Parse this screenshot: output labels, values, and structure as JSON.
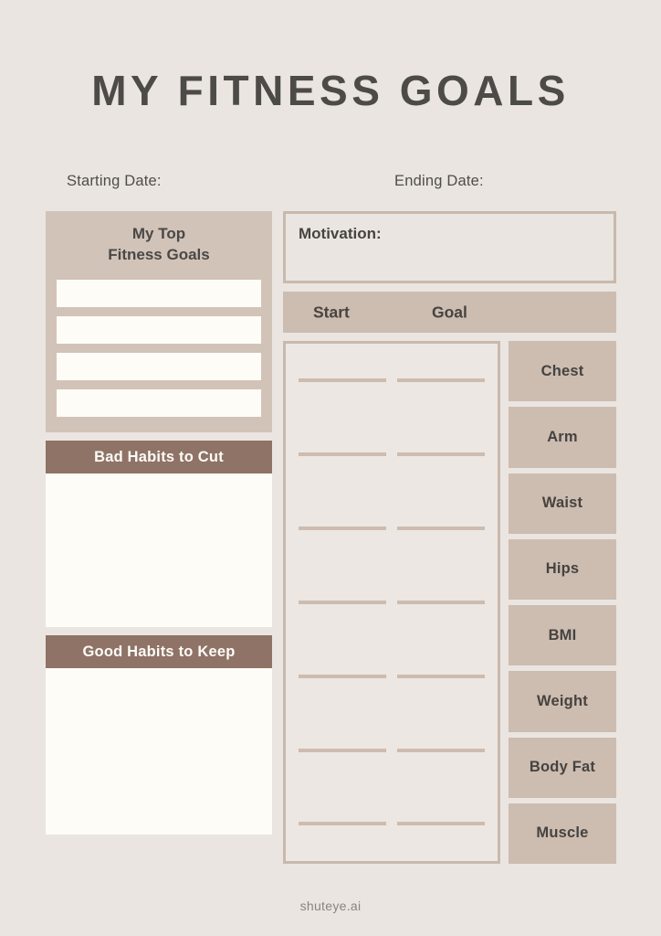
{
  "page": {
    "title": "MY FITNESS GOALS",
    "background_color": "#EAE5E0",
    "panel_color": "#D2C3B8",
    "header_brown": "#8E7366",
    "writing_cream": "#FDFCF7",
    "text_color": "#4A4845"
  },
  "dates": {
    "start_label": "Starting Date:",
    "end_label": "Ending Date:"
  },
  "top_goals": {
    "title": "My Top\nFitness Goals",
    "rows": [
      "",
      "",
      "",
      ""
    ]
  },
  "habits": {
    "bad": {
      "header": "Bad Habits to Cut",
      "body": ""
    },
    "good": {
      "header": "Good Habits to Keep",
      "body": ""
    }
  },
  "motivation": {
    "label": "Motivation:",
    "value": ""
  },
  "tracker": {
    "column_headers": [
      "Start",
      "Goal"
    ],
    "line_rows": 7,
    "measurements": [
      "Chest",
      "Arm",
      "Waist",
      "Hips",
      "BMI",
      "Weight",
      "Body Fat",
      "Muscle"
    ]
  },
  "footer": {
    "watermark": "shuteye.ai"
  }
}
